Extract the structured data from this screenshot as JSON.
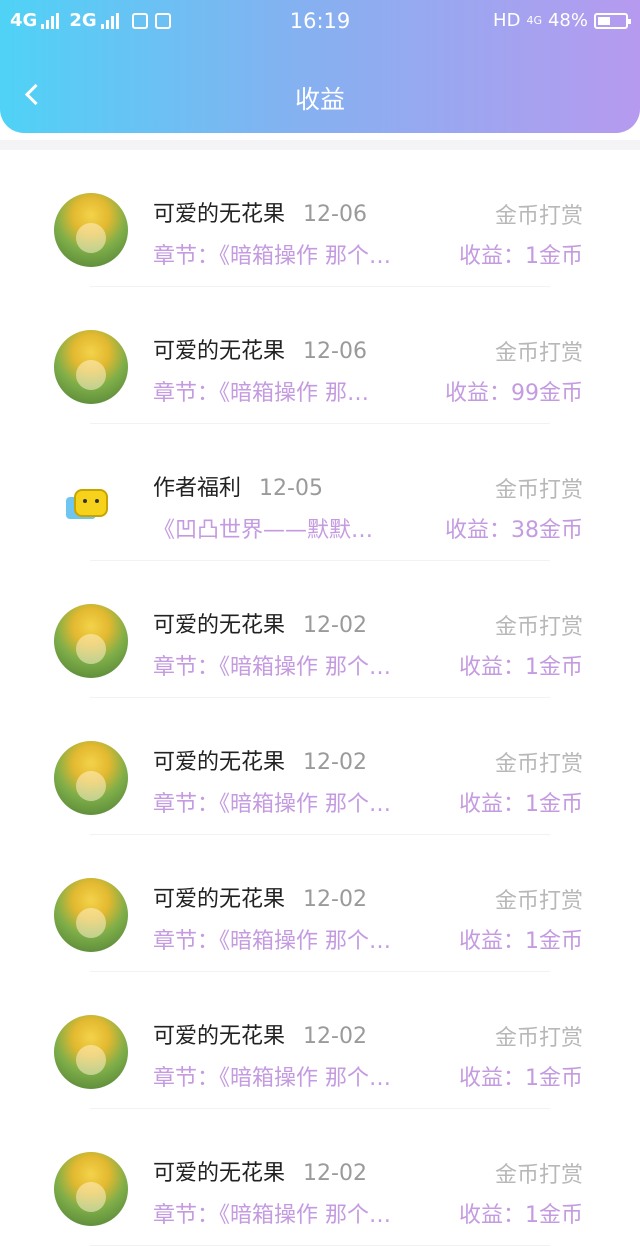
{
  "status_bar": {
    "network1": "4G",
    "network2": "2G",
    "time": "16:19",
    "hd": "HD",
    "net4g": "4G",
    "battery": "48%"
  },
  "header": {
    "title": "收益"
  },
  "records": [
    {
      "name": "可爱的无花果",
      "date": "12-06",
      "type": "金币打赏",
      "chapter": "章节：《暗箱操作 那个…",
      "income": "收益：1金币",
      "avatar": "sunflower"
    },
    {
      "name": "可爱的无花果",
      "date": "12-06",
      "type": "金币打赏",
      "chapter": "章节：《暗箱操作 那…",
      "income": "收益：99金币",
      "avatar": "sunflower"
    },
    {
      "name": "作者福利",
      "date": "12-05",
      "type": "金币打赏",
      "chapter": "《凹凸世界——默默…",
      "income": "收益：38金币",
      "avatar": "emoji"
    },
    {
      "name": "可爱的无花果",
      "date": "12-02",
      "type": "金币打赏",
      "chapter": "章节：《暗箱操作 那个…",
      "income": "收益：1金币",
      "avatar": "sunflower"
    },
    {
      "name": "可爱的无花果",
      "date": "12-02",
      "type": "金币打赏",
      "chapter": "章节：《暗箱操作 那个…",
      "income": "收益：1金币",
      "avatar": "sunflower"
    },
    {
      "name": "可爱的无花果",
      "date": "12-02",
      "type": "金币打赏",
      "chapter": "章节：《暗箱操作 那个…",
      "income": "收益：1金币",
      "avatar": "sunflower"
    },
    {
      "name": "可爱的无花果",
      "date": "12-02",
      "type": "金币打赏",
      "chapter": "章节：《暗箱操作 那个…",
      "income": "收益：1金币",
      "avatar": "sunflower"
    },
    {
      "name": "可爱的无花果",
      "date": "12-02",
      "type": "金币打赏",
      "chapter": "章节：《暗箱操作 那个…",
      "income": "收益：1金币",
      "avatar": "sunflower"
    }
  ],
  "colors": {
    "header_start": "#4fd2f6",
    "header_end": "#b69af0",
    "accent": "#c49be0",
    "muted": "#b8b8b8"
  }
}
